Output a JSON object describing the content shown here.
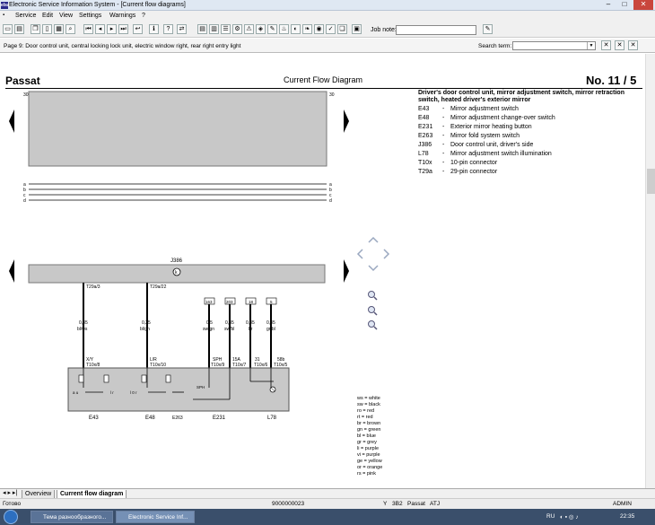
{
  "window": {
    "logo": "elsa",
    "title": "Electronic Service Information System - [Current flow diagrams]",
    "min": "–",
    "max": "□",
    "close": "✕"
  },
  "menu": [
    "Service",
    "Edit",
    "View",
    "Settings",
    "Warnings",
    "?"
  ],
  "toolbar": {
    "job_note_label": "Job note:",
    "buttons": [
      "save-icon",
      "print-icon",
      "first-icon",
      "prev-icon",
      "next-icon",
      "last-icon",
      "back-icon",
      "info-icon",
      "help-icon",
      "swap-icon",
      "doc-icon",
      "book-icon",
      "list-icon",
      "gear-icon",
      "warning-icon",
      "car-icon",
      "wrench-icon",
      "oil-icon",
      "seat-icon",
      "check-icon",
      "stamp-icon",
      "pages-icon",
      "clipboard-icon"
    ]
  },
  "pagebar": {
    "page_text": "Page 9: Door control unit, central locking lock unit, electric window right, rear right entry light",
    "search_label": "Search term:",
    "search_value": ""
  },
  "document": {
    "model": "Passat",
    "title": "Current Flow Diagram",
    "number": "No.  11 / 5",
    "legend_title": "Driver's door control unit, mirror adjustment switch, mirror retraction switch, heated driver's exterior mirror",
    "legend": [
      {
        "code": "E43",
        "desc": "Mirror adjustment switch"
      },
      {
        "code": "E48",
        "desc": "Mirror adjustment change-over switch"
      },
      {
        "code": "E231",
        "desc": "Exterior mirror heating button"
      },
      {
        "code": "E263",
        "desc": "Mirror fold system switch"
      },
      {
        "code": "J386",
        "desc": "Door control unit, driver's side"
      },
      {
        "code": "L78",
        "desc": "Mirror adjustment switch illumination"
      },
      {
        "code": "T10x",
        "desc": "10-pin connector"
      },
      {
        "code": "T29a",
        "desc": "29-pin connector"
      }
    ],
    "colors": [
      "ws = white",
      "sw = black",
      "ro = red",
      "rt = red",
      "br = brown",
      "gn = green",
      "bl = blue",
      "gr = grey",
      "li = purple",
      "vi = purple",
      "ge = yellow",
      "or = orange",
      "rs = pink"
    ],
    "diagram_labels": {
      "rail_30": "30",
      "rail_a": "a",
      "rail_b": "b",
      "rail_c": "c",
      "rail_d": "d",
      "j386": "J386",
      "k": "k",
      "conn1": "T29a/3",
      "conn2": "T29a/22",
      "wire1_size": "0,35",
      "wire1_col": "bl/ws",
      "wire2_size": "0,35",
      "wire2_col": "bl/gn",
      "wire3_size": "0,5",
      "wire3_col": "sw/gn",
      "wire4_size": "0,35",
      "wire4_col": "sw/bl",
      "wire5_size": "0,35",
      "wire5_col": "br",
      "wire6_size": "0,35",
      "wire6_col": "gr/bl",
      "box1": "163",
      "box2": "203",
      "box3": "18",
      "box4": "5",
      "pin1": "X/Y",
      "pin1c": "T10x/8",
      "pin2": "L/R",
      "pin2c": "T10x/10",
      "pin3": "SPH",
      "pin3c": "T10x/9",
      "pin4": "15A",
      "pin4c": "T10x/7",
      "pin5": "31",
      "pin5c": "T10x/6",
      "pin6": "58b",
      "pin6c": "T10x/5",
      "sw_l": "a u",
      "sw_r": "l r",
      "sw_mid": "l 0 r",
      "sw_sph": "SPH",
      "e43": "E43",
      "e48": "E48",
      "e263": "E263",
      "e231": "E231",
      "l78": "L78"
    }
  },
  "tabs": [
    "Overview",
    "Current flow diagram"
  ],
  "status": {
    "ready": "Готово",
    "code": "9000000023",
    "y": "Y",
    "num": "3B2",
    "model": "Passat",
    "atj": "ATJ",
    "user": "ADMIN"
  },
  "taskbar": {
    "items": [
      "Тема разнообразного...",
      "Electronic Service Inf..."
    ],
    "lang": "RU",
    "time": "22:35"
  }
}
